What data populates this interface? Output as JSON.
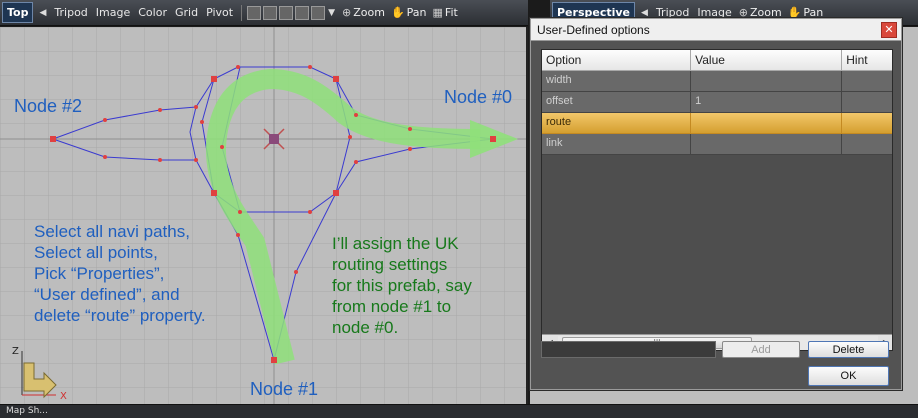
{
  "toolbar_left": {
    "view_label": "Top",
    "menu": [
      "Tripod",
      "Image",
      "Color",
      "Grid",
      "Pivot"
    ],
    "zoom_label": "Zoom",
    "pan_label": "Pan",
    "fit_label": "Fit"
  },
  "toolbar_right": {
    "view_label": "Perspective",
    "menu": [
      "Tripod",
      "Image"
    ],
    "zoom_label": "Zoom",
    "pan_label": "Pan"
  },
  "viewport": {
    "node_labels": {
      "node2": "Node #2",
      "node0": "Node #0",
      "node1": "Node #1"
    },
    "instructions_left": "Select all navi paths,\nSelect all points,\nPick “Properties”,\n“User defined”, and\ndelete “route” property.",
    "instructions_right": "I’ll assign the UK\nrouting settings\nfor this prefab, say\nfrom node #1 to\nnode #0.",
    "axis": {
      "z": "Z",
      "x": "X"
    },
    "colors": {
      "path_line": "#3a3ad0",
      "route_arrow": "#8fe07a",
      "point": "#e04040",
      "label_blue": "#1f5fbf",
      "label_green": "#17791b"
    }
  },
  "dialog": {
    "title": "User-Defined options",
    "close_glyph": "✕",
    "columns": [
      "Option",
      "Value",
      "Hint"
    ],
    "rows": [
      {
        "option": "width",
        "value": "",
        "hint": ""
      },
      {
        "option": "offset",
        "value": "1",
        "hint": ""
      },
      {
        "option": "route",
        "value": "",
        "hint": "",
        "selected": true
      },
      {
        "option": "link",
        "value": "",
        "hint": ""
      }
    ],
    "scroll_grip": "III",
    "add_label": "Add",
    "delete_label": "Delete",
    "ok_label": "OK"
  },
  "status": {
    "tab_label": "Map Sh..."
  }
}
